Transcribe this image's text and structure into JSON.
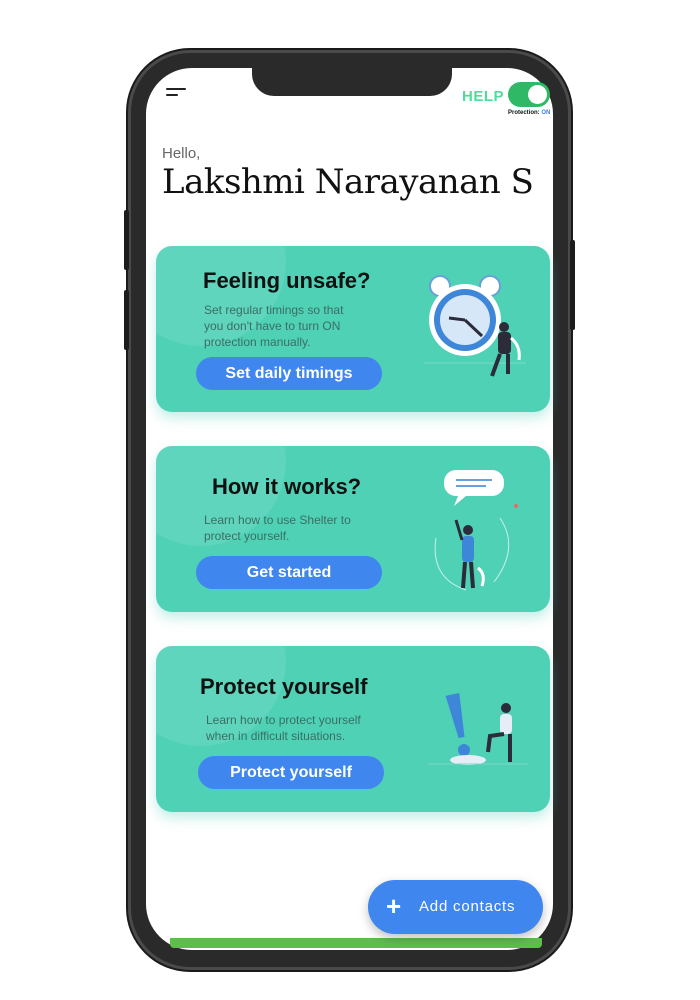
{
  "header": {
    "help_label": "HELP",
    "protection_label": "Protection:",
    "protection_value": "ON"
  },
  "greeting": {
    "hello": "Hello,",
    "name": "Lakshmi Narayanan S"
  },
  "cards": [
    {
      "title": "Feeling unsafe?",
      "description": "Set regular timings so that\nyou don't have to turn ON\nprotection manually.",
      "button": "Set daily timings",
      "illustration": "alarm-clock-illustration"
    },
    {
      "title": "How it works?",
      "description": "Learn how to use Shelter to\nprotect yourself.",
      "button": "Get started",
      "illustration": "speech-bubble-person-illustration"
    },
    {
      "title": "Protect yourself",
      "description": "Learn how to protect yourself\nwhen in difficult situations.",
      "button": "Protect yourself",
      "illustration": "exclamation-person-illustration"
    }
  ],
  "fab": {
    "label": "Add contacts",
    "icon": "plus-icon"
  },
  "colors": {
    "card": "#4fd1b6",
    "button": "#3f86ef",
    "toggle_on": "#2fb866",
    "help": "#4fdb9a"
  }
}
